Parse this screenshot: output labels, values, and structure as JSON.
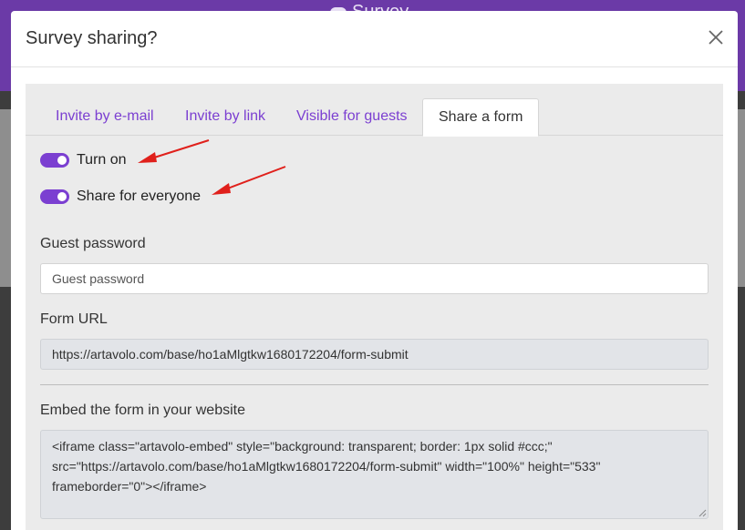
{
  "background": {
    "app_title": "Survey",
    "header_color": "#6b3aa7"
  },
  "modal": {
    "title": "Survey sharing?",
    "close_icon": "close-icon"
  },
  "tabs": [
    {
      "label": "Invite by e-mail",
      "active": false
    },
    {
      "label": "Invite by link",
      "active": false
    },
    {
      "label": "Visible for guests",
      "active": false
    },
    {
      "label": "Share a form",
      "active": true
    }
  ],
  "toggles": {
    "turn_on": {
      "label": "Turn on",
      "checked": true
    },
    "share_everyone": {
      "label": "Share for everyone",
      "checked": true
    }
  },
  "guest_password": {
    "label": "Guest password",
    "placeholder": "Guest password",
    "value": ""
  },
  "form_url": {
    "label": "Form URL",
    "value": "https://artavolo.com/base/ho1aMlgtkw1680172204/form-submit"
  },
  "embed": {
    "label": "Embed the form in your website",
    "code": "<iframe class=\"artavolo-embed\" style=\"background: transparent; border: 1px solid #ccc;\" src=\"https://artavolo.com/base/ho1aMlgtkw1680172204/form-submit\" width=\"100%\" height=\"533\" frameborder=\"0\"></iframe>"
  },
  "colors": {
    "accent": "#7b3fd1",
    "annotation_arrow": "#e0201b"
  }
}
